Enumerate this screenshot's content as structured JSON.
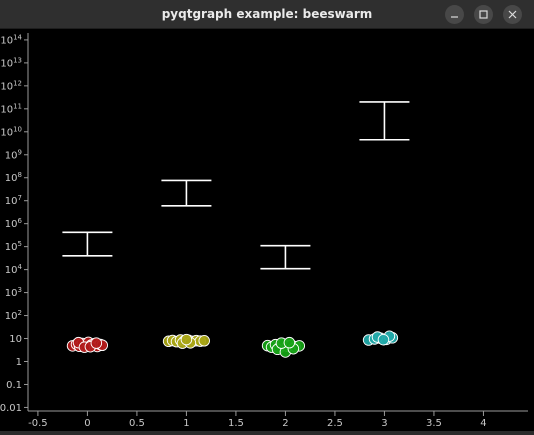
{
  "window": {
    "title": "pyqtgraph example: beeswarm",
    "buttons": {
      "minimize": "minimize-icon",
      "maximize": "maximize-icon",
      "close": "close-icon"
    }
  },
  "chart_data": {
    "type": "scatter",
    "title": "",
    "xlabel": "",
    "ylabel": "",
    "y_scale": "log",
    "xlim": [
      -0.6,
      4.45
    ],
    "ylim": [
      0.007,
      200000000000000.0
    ],
    "x_ticks": [
      "-0.5",
      "0",
      "0.5",
      "1",
      "1.5",
      "2",
      "2.5",
      "3",
      "3.5",
      "4"
    ],
    "x_tick_values": [
      -0.5,
      0,
      0.5,
      1,
      1.5,
      2,
      2.5,
      3,
      3.5,
      4
    ],
    "y_ticks": [
      {
        "base": "0.01",
        "exp": ""
      },
      {
        "base": "0.1",
        "exp": ""
      },
      {
        "base": "1",
        "exp": ""
      },
      {
        "base": "10",
        "exp": ""
      },
      {
        "base": "10",
        "exp": "2"
      },
      {
        "base": "10",
        "exp": "3"
      },
      {
        "base": "10",
        "exp": "4"
      },
      {
        "base": "10",
        "exp": "5"
      },
      {
        "base": "10",
        "exp": "6"
      },
      {
        "base": "10",
        "exp": "7"
      },
      {
        "base": "10",
        "exp": "8"
      },
      {
        "base": "10",
        "exp": "9"
      },
      {
        "base": "10",
        "exp": "10"
      },
      {
        "base": "10",
        "exp": "11"
      },
      {
        "base": "10",
        "exp": "12"
      },
      {
        "base": "10",
        "exp": "13"
      },
      {
        "base": "10",
        "exp": "14"
      }
    ],
    "y_tick_values": [
      0.01,
      0.1,
      1,
      10,
      100,
      1000,
      10000,
      100000,
      1000000,
      10000000,
      100000000,
      1000000000,
      10000000000,
      100000000000,
      1000000000000,
      10000000000000,
      100000000000000
    ],
    "series": [
      {
        "color": "#b01818",
        "x": [
          -0.15,
          -0.11,
          -0.08,
          -0.05,
          -0.02,
          0.01,
          0.04,
          0.07,
          0.1,
          0.13,
          0.15,
          -0.09,
          -0.03,
          0.03,
          0.09
        ],
        "y": [
          4.8,
          5.6,
          4.6,
          6.1,
          5.0,
          6.8,
          5.2,
          5.9,
          4.5,
          5.5,
          5.1,
          6.6,
          4.2,
          4.4,
          6.3
        ]
      },
      {
        "color": "#a8a414",
        "x": [
          0.82,
          0.86,
          0.9,
          0.94,
          0.98,
          1.02,
          1.06,
          1.1,
          1.14,
          1.18,
          0.96,
          1.04,
          1.0
        ],
        "y": [
          7.6,
          8.2,
          7.3,
          8.6,
          7.9,
          8.4,
          7.5,
          8.1,
          7.7,
          8.0,
          6.3,
          6.5,
          9.0
        ]
      },
      {
        "color": "#14a014",
        "x": [
          1.82,
          1.86,
          1.9,
          1.94,
          1.98,
          2.02,
          2.06,
          2.1,
          2.14,
          1.92,
          2.0,
          2.08,
          1.96,
          2.04
        ],
        "y": [
          4.9,
          4.2,
          5.4,
          4.0,
          5.8,
          4.6,
          5.2,
          4.4,
          4.8,
          3.4,
          2.6,
          3.6,
          6.3,
          6.6
        ]
      },
      {
        "color": "#20a8a8",
        "x": [
          2.84,
          2.9,
          2.96,
          3.02,
          3.08,
          2.93,
          3.05,
          2.99
        ],
        "y": [
          8.6,
          9.6,
          10.4,
          9.2,
          10.8,
          11.6,
          12.6,
          8.9
        ]
      }
    ],
    "error_bars": [
      {
        "x": 0,
        "low": 40000,
        "high": 420000
      },
      {
        "x": 1,
        "low": 6000000,
        "high": 76000000
      },
      {
        "x": 2,
        "low": 11000,
        "high": 110000
      },
      {
        "x": 3,
        "low": 4500000000,
        "high": 200000000000
      }
    ]
  }
}
